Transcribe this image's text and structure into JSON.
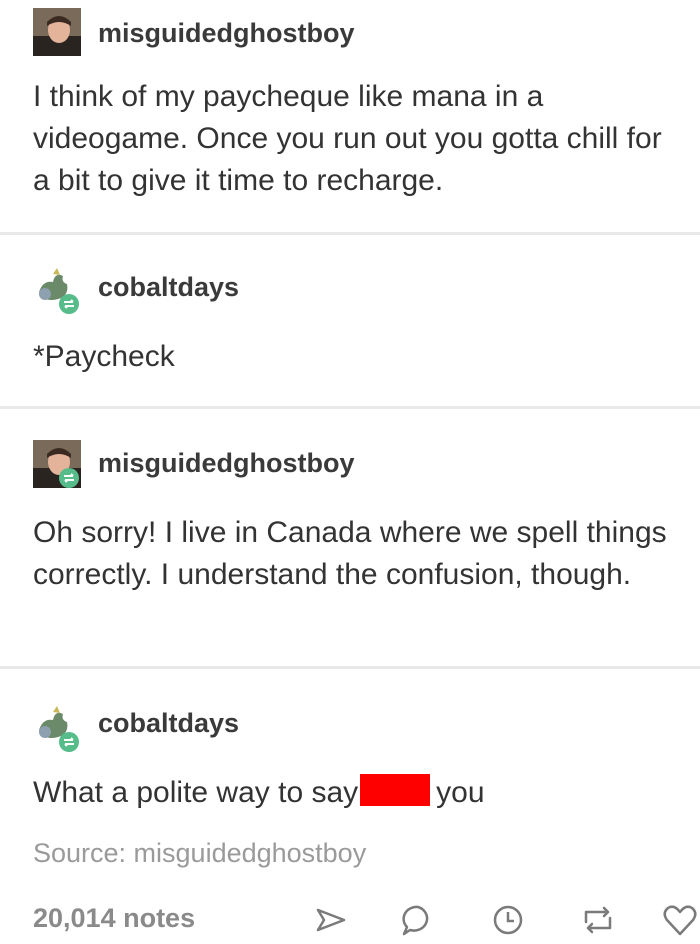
{
  "posts": [
    {
      "username": "misguidedghostboy",
      "text": "I think of my paycheque like mana in a videogame. Once you run out you gotta chill for a bit to give it time to recharge.",
      "avatar_icon": "profile-photo-icon"
    },
    {
      "username": "cobaltdays",
      "text": "*Paycheck",
      "avatar_icon": "pokemon-avatar-icon"
    },
    {
      "username": "misguidedghostboy",
      "text": "Oh sorry! I live in Canada where we spell things correctly. I understand the confusion, though.",
      "avatar_icon": "profile-photo-icon"
    },
    {
      "username": "cobaltdays",
      "text_before": "What a polite way to say",
      "text_after": "you",
      "avatar_icon": "pokemon-avatar-icon"
    }
  ],
  "source": "Source: misguidedghostboy",
  "notes": "20,014 notes",
  "actions": [
    "share-icon",
    "reply-icon",
    "queue-icon",
    "reblog-icon",
    "like-icon"
  ],
  "colors": {
    "reblog_badge": "#56bc8a",
    "censor": "#ff0000",
    "muted_text": "#9a9a9a"
  }
}
